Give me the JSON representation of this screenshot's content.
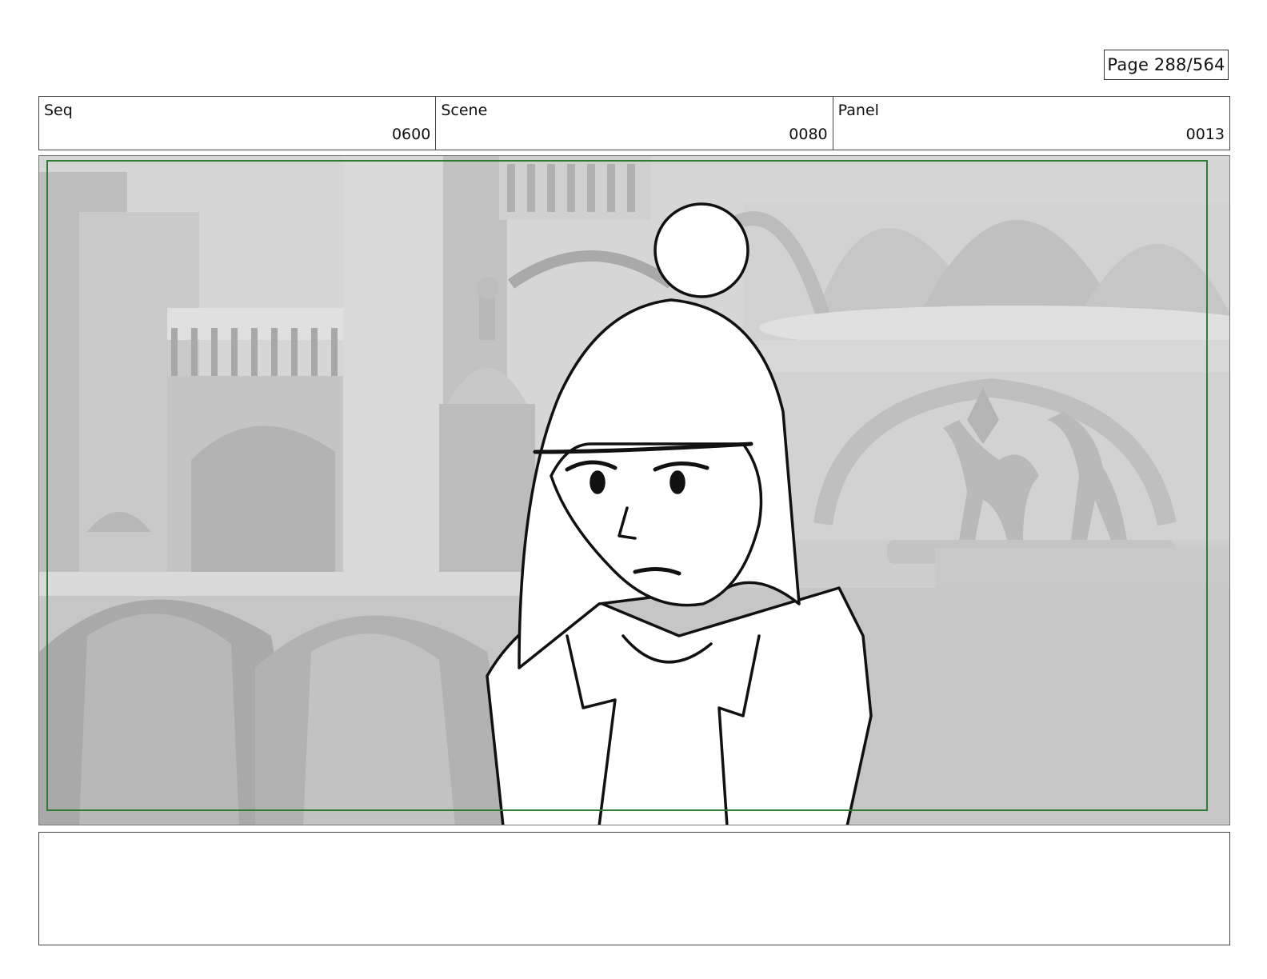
{
  "page": {
    "label": "Page 288/564"
  },
  "header": {
    "seq": {
      "label": "Seq",
      "value": "0600"
    },
    "scene": {
      "label": "Scene",
      "value": "0080"
    },
    "panel": {
      "label": "Panel",
      "value": "0013"
    }
  },
  "notes": {
    "text": ""
  },
  "colors": {
    "safe_frame": "#2e7d32",
    "border": "#444444",
    "background_render": "#cfcfcf"
  }
}
